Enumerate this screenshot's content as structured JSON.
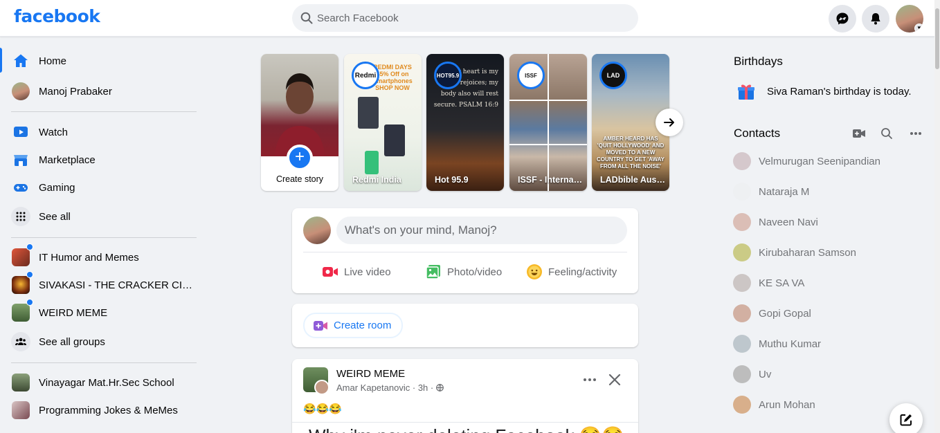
{
  "app": {
    "logo": "facebook"
  },
  "search": {
    "placeholder": "Search Facebook"
  },
  "topbar": {
    "icons": [
      "messenger-icon",
      "notifications-icon",
      "account-icon"
    ]
  },
  "sidebar": {
    "nav": [
      {
        "label": "Home",
        "icon": "home-icon",
        "active": true
      },
      {
        "label": "Manoj Prabaker",
        "icon": "avatar"
      }
    ],
    "menu": [
      {
        "label": "Watch",
        "icon": "watch-icon"
      },
      {
        "label": "Marketplace",
        "icon": "marketplace-icon"
      },
      {
        "label": "Gaming",
        "icon": "gaming-icon"
      },
      {
        "label": "See all",
        "icon": "grid-icon"
      }
    ],
    "groups": [
      {
        "label": "IT Humor and Memes",
        "unread": true
      },
      {
        "label": "SIVAKASI - THE CRACKER CITY(...",
        "unread": true
      },
      {
        "label": "WEIRD MEME",
        "unread": true
      },
      {
        "label": "See all groups",
        "icon": "groups-icon"
      }
    ],
    "shortcuts": [
      {
        "label": "Vinayagar Mat.Hr.Sec School"
      },
      {
        "label": "Programming Jokes & MeMes"
      }
    ]
  },
  "stories": {
    "create_label": "Create story",
    "items": [
      {
        "name": "Redmi India",
        "badge": "Redmi",
        "card_text": "REDMI DAYS 45% Off on Smartphones SHOP NOW"
      },
      {
        "name": "Hot 95.9",
        "badge": "HOT95.9",
        "card_text": "my heart is my tongue rejoices; my body also will rest secure. PSALM 16:9"
      },
      {
        "name": "ISSF - International...",
        "badge": "ISSF"
      },
      {
        "name": "LADbible Australia",
        "badge": "LAD",
        "card_text": "AMBER HEARD HAS 'QUIT HOLLYWOOD' AND MOVED TO A NEW COUNTRY TO GET 'AWAY FROM ALL THE NOISE'"
      }
    ]
  },
  "composer": {
    "placeholder": "What's on your mind, Manoj?",
    "actions": [
      {
        "label": "Live video",
        "icon": "live-video-icon",
        "color": "#f02849"
      },
      {
        "label": "Photo/video",
        "icon": "photo-icon",
        "color": "#45bd62"
      },
      {
        "label": "Feeling/activity",
        "icon": "feeling-icon",
        "color": "#f7b928"
      }
    ]
  },
  "room": {
    "label": "Create room"
  },
  "post": {
    "group": "WEIRD MEME",
    "author": "Amar Kapetanovic",
    "time": "3h",
    "emoji": "😂😂😂",
    "text": "Why i'm never deleting Facebook 😂😂"
  },
  "right": {
    "birthdays_title": "Birthdays",
    "birthday_name": "Siva Raman",
    "birthday_text": "'s birthday is today.",
    "contacts_title": "Contacts",
    "contacts": [
      "Velmurugan Seenipandian",
      "Nataraja M",
      "Naveen Navi",
      "Kirubaharan Samson",
      "KE SA VA",
      "Gopi Gopal",
      "Muthu Kumar",
      "Uv",
      "Arun Mohan"
    ]
  },
  "colors": {
    "brand": "#1877f2",
    "background": "#f0f2f5",
    "card": "#ffffff",
    "secondary_text": "#65676b"
  }
}
